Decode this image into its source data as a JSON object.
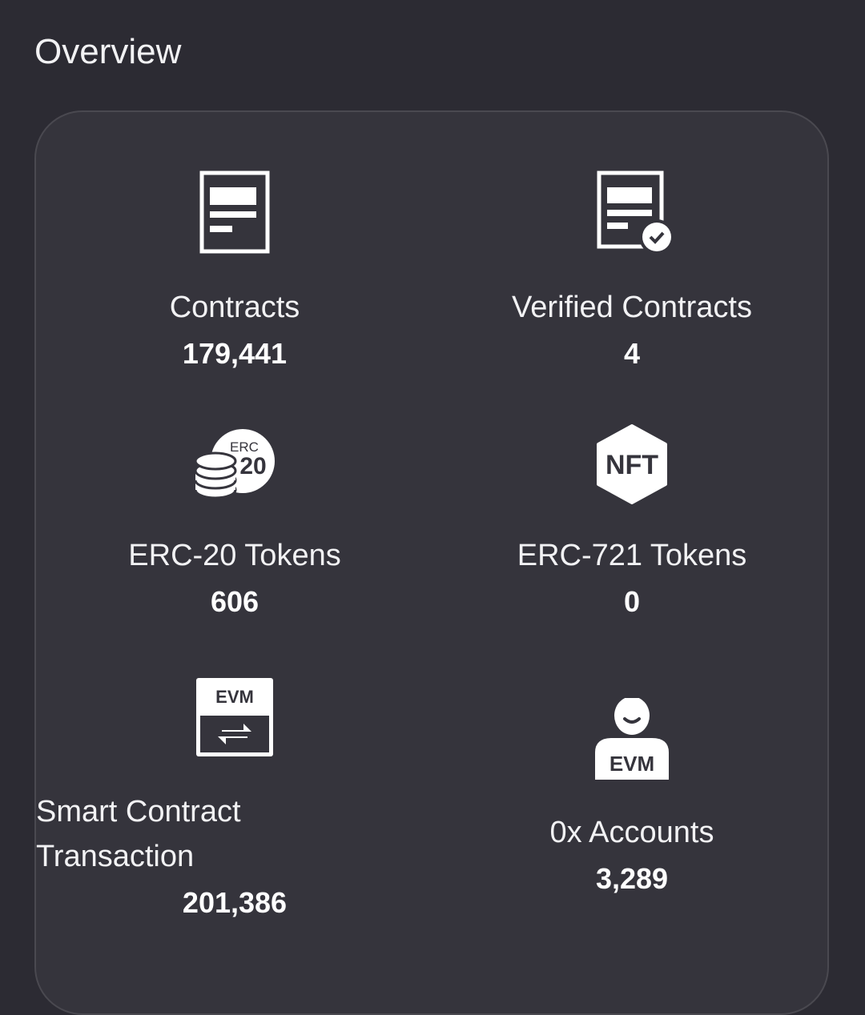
{
  "header": {
    "title": "Overview"
  },
  "stats": [
    {
      "label": "Contracts",
      "value": "179,441",
      "icon": "contract-icon"
    },
    {
      "label": "Verified Contracts",
      "value": "4",
      "icon": "verified-contract-icon"
    },
    {
      "label": "ERC-20 Tokens",
      "value": "606",
      "icon": "erc20-coins-icon",
      "icon_text_top": "ERC",
      "icon_text_bottom": "20"
    },
    {
      "label": "ERC-721 Tokens",
      "value": "0",
      "icon": "nft-hexagon-icon",
      "icon_text": "NFT"
    },
    {
      "label_line1": "Smart Contract",
      "label_line2": "Transaction",
      "value": "201,386",
      "icon": "evm-transaction-icon",
      "icon_text": "EVM"
    },
    {
      "label": "0x Accounts",
      "value": "3,289",
      "icon": "evm-account-icon",
      "icon_text": "EVM"
    }
  ],
  "colors": {
    "background": "#2c2b33",
    "card": "#35343c",
    "border": "#4a4950",
    "text": "#ffffff"
  }
}
